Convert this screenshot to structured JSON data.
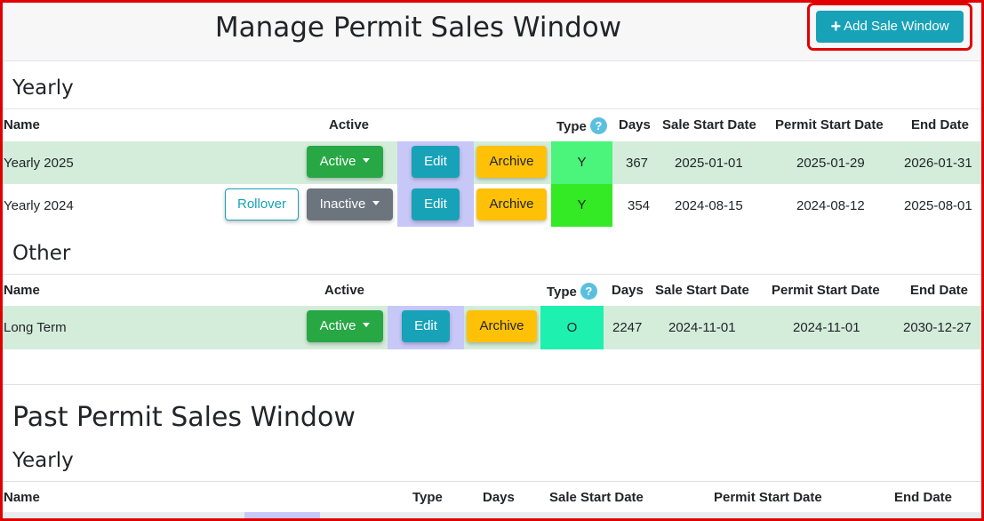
{
  "header": {
    "title": "Manage Permit Sales Window",
    "add_button": "Add Sale Window"
  },
  "columns": {
    "name": "Name",
    "active": "Active",
    "type": "Type",
    "days": "Days",
    "sale_start": "Sale Start Date",
    "permit_start": "Permit Start Date",
    "end": "End Date"
  },
  "sections": {
    "yearly": {
      "title": "Yearly",
      "rows": [
        {
          "name": "Yearly 2025",
          "status": "Active",
          "edit": "Edit",
          "archive": "Archive",
          "type": "Y",
          "type_color": "#4bf47a",
          "days": "367",
          "sale_start": "2025-01-01",
          "permit_start": "2025-01-29",
          "end": "2026-01-31"
        },
        {
          "name": "Yearly 2024",
          "rollover": "Rollover",
          "status": "Inactive",
          "edit": "Edit",
          "archive": "Archive",
          "type": "Y",
          "type_color": "#33ea24",
          "days": "354",
          "sale_start": "2024-08-15",
          "permit_start": "2024-08-12",
          "end": "2025-08-01"
        }
      ]
    },
    "other": {
      "title": "Other",
      "rows": [
        {
          "name": "Long Term",
          "status": "Active",
          "edit": "Edit",
          "archive": "Archive",
          "type": "O",
          "type_color": "#1ef0b0",
          "days": "2247",
          "sale_start": "2024-11-01",
          "permit_start": "2024-11-01",
          "end": "2030-12-27"
        }
      ]
    }
  },
  "past": {
    "title": "Past Permit Sales Window",
    "yearly_title": "Yearly"
  },
  "icons": {
    "help": "?",
    "add": "+"
  },
  "colors": {
    "accent": "#17a2b8",
    "success": "#28a745",
    "warning": "#ffc107",
    "secondary": "#6c757d",
    "row_highlight": "#d4edda",
    "frame": "#e00000"
  }
}
